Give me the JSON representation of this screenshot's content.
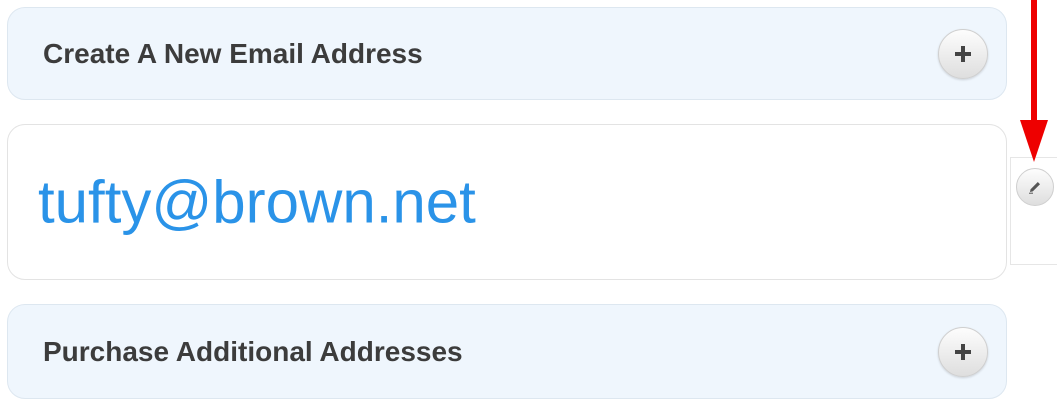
{
  "panels": {
    "create": {
      "title": "Create A New Email Address",
      "action_icon": "plus-icon"
    },
    "email": {
      "address": "tufty@brown.net",
      "edit_icon": "pencil-icon"
    },
    "purchase": {
      "title": "Purchase Additional Addresses",
      "action_icon": "plus-icon"
    }
  },
  "annotation": {
    "arrow_color": "#ee0000"
  },
  "colors": {
    "panel_bg": "#eff6fd",
    "email_text": "#2a93e8",
    "title_text": "#3c3c3c"
  }
}
